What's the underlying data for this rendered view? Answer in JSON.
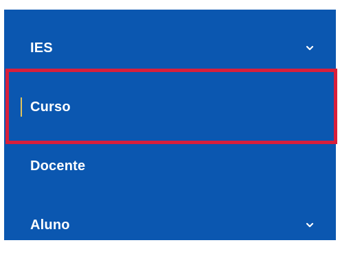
{
  "menu": {
    "items": [
      {
        "label": "IES",
        "has_submenu": true,
        "active": false
      },
      {
        "label": "Curso",
        "has_submenu": false,
        "active": true
      },
      {
        "label": "Docente",
        "has_submenu": false,
        "active": false
      },
      {
        "label": "Aluno",
        "has_submenu": true,
        "active": false
      }
    ]
  },
  "colors": {
    "background": "#0b57b0",
    "text": "#ffffff",
    "active_indicator": "#e3c45a",
    "highlight_border": "#d81f3b"
  },
  "icons": {
    "submenu": "chevron-down-icon"
  }
}
